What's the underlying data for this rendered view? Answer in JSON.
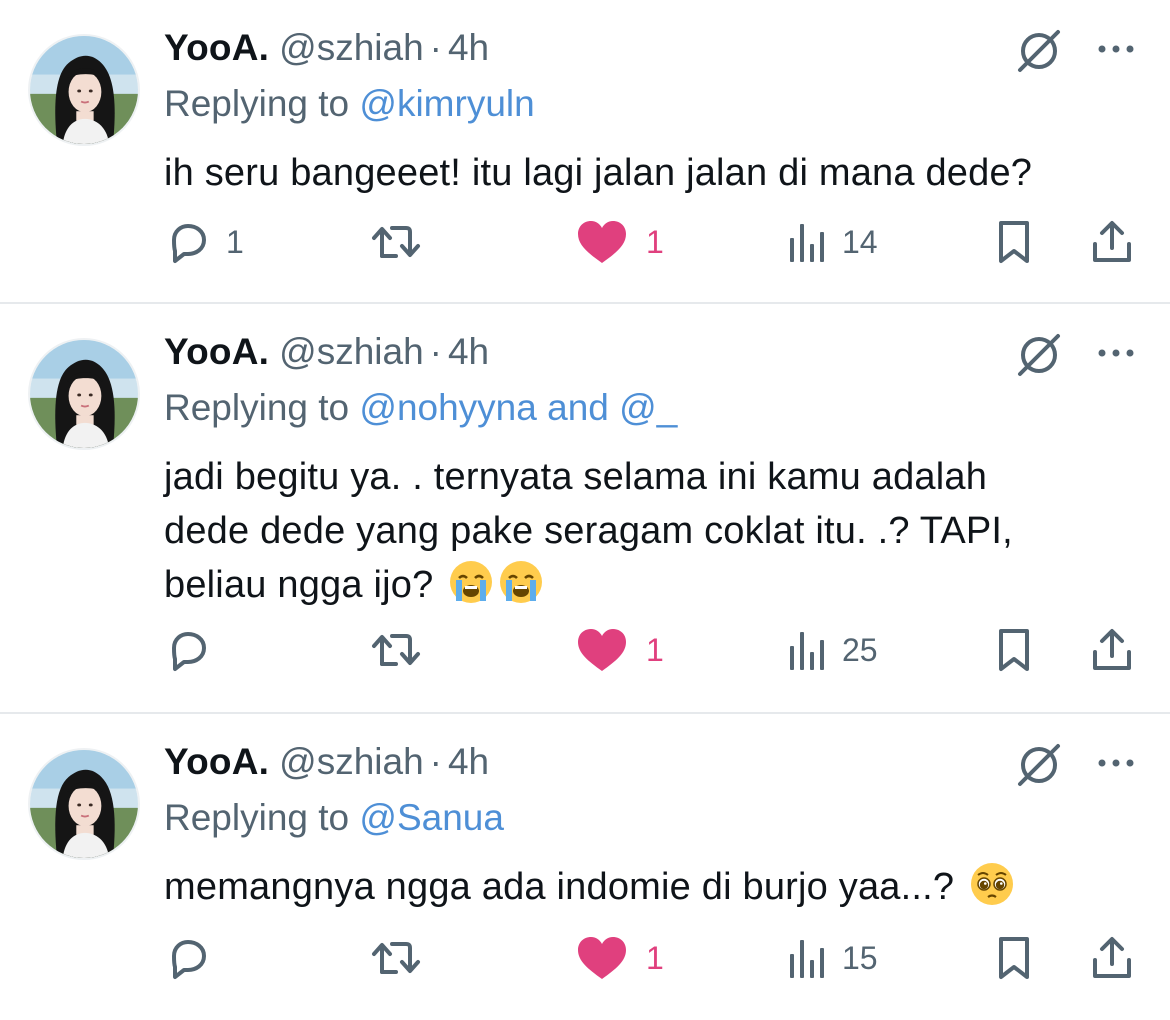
{
  "tweets": [
    {
      "author_name": "YooA.",
      "author_handle": "@szhiah",
      "separator": "·",
      "time": "4h",
      "replying_prefix": "Replying to",
      "replying_to": "@kimryuln",
      "text_lines": [
        "ih seru bangeeet! itu lagi jalan jalan di mana dede?"
      ],
      "reply_count": "1",
      "retweet_count": "",
      "like_count": "1",
      "view_count": "14"
    },
    {
      "author_name": "YooA.",
      "author_handle": "@szhiah",
      "separator": "·",
      "time": "4h",
      "replying_prefix": "Replying to",
      "replying_to": "@nohyyna and @_",
      "text_lines": [
        "jadi begitu ya. . ternyata selama ini kamu adalah",
        "dede dede yang pake seragam coklat itu. .? TAPI,",
        "beliau ngga ijo?"
      ],
      "emoji": [
        "😭",
        "😭"
      ],
      "reply_count": "",
      "retweet_count": "",
      "like_count": "1",
      "view_count": "25"
    },
    {
      "author_name": "YooA.",
      "author_handle": "@szhiah",
      "separator": "·",
      "time": "4h",
      "replying_prefix": "Replying to",
      "replying_to": "@Sanua",
      "text_lines": [
        "memangnya ngga ada indomie di burjo yaa...?"
      ],
      "emoji": [
        "🥺"
      ],
      "reply_count": "",
      "retweet_count": "",
      "like_count": "1",
      "view_count": "15"
    }
  ],
  "icons": {
    "mute": "mute-conversation-icon",
    "more": "more-options-icon",
    "reply": "reply-icon",
    "retweet": "retweet-icon",
    "like": "heart-icon",
    "views": "views-icon",
    "bookmark": "bookmark-icon",
    "share": "share-icon"
  },
  "colors": {
    "text": "#0f1419",
    "secondary": "#536471",
    "mention": "#4e8fd6",
    "like": "#e0407e",
    "divider": "#e6e9ec"
  }
}
